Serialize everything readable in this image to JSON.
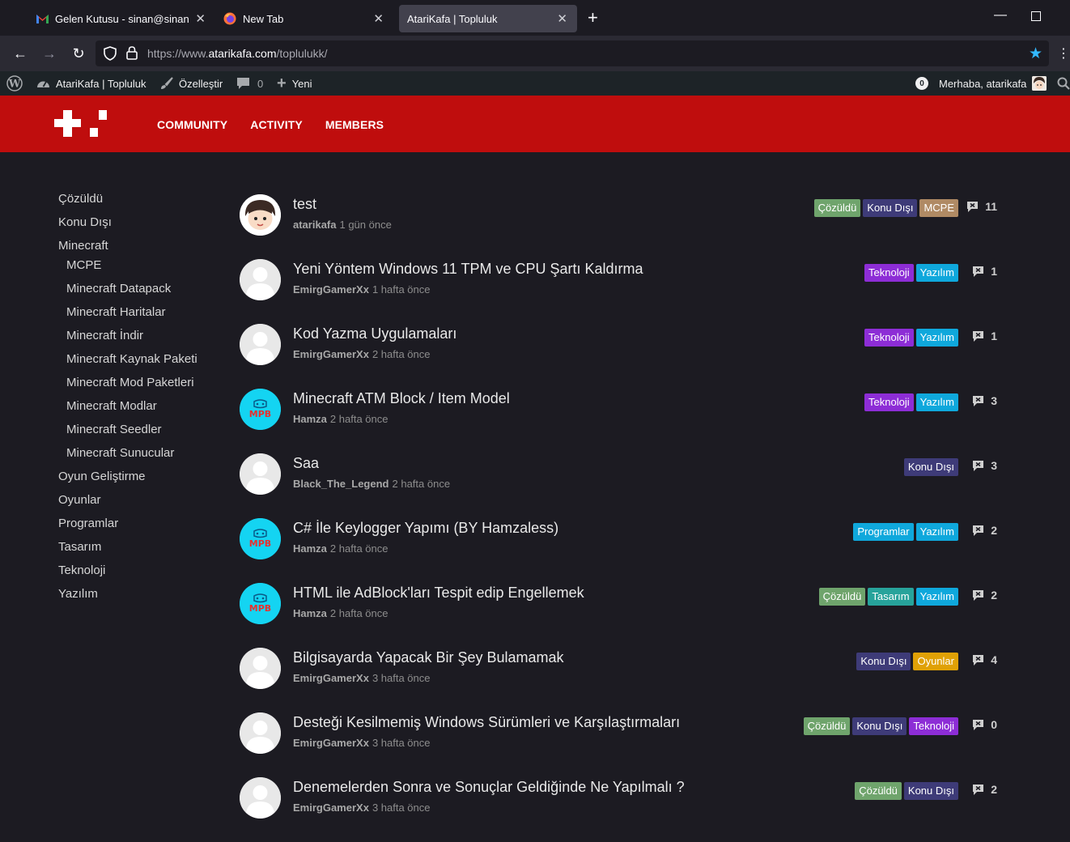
{
  "browser": {
    "tabs": [
      {
        "title": "Gelen Kutusu - sinan@sinanisle",
        "icon": "gmail-icon"
      },
      {
        "title": "New Tab",
        "icon": "firefox-icon"
      },
      {
        "title": "AtariKafa | Topluluk",
        "icon": "none",
        "active": true
      }
    ],
    "url_prefix": "https://www.",
    "url_domain": "atarikafa.com",
    "url_path": "/toplulukk/"
  },
  "adminbar": {
    "site": "AtariKafa | Topluluk",
    "customize": "Özelleştir",
    "comments": "0",
    "new": "Yeni",
    "notifications": "0",
    "greeting": "Merhaba, atarikafa"
  },
  "nav": {
    "items": [
      "COMMUNITY",
      "ACTIVITY",
      "MEMBERS"
    ]
  },
  "sidebar": {
    "items": [
      {
        "label": "Çözüldü",
        "sub": false
      },
      {
        "label": "Konu Dışı",
        "sub": false
      },
      {
        "label": "Minecraft",
        "sub": false,
        "tight": true
      },
      {
        "label": "MCPE",
        "sub": true
      },
      {
        "label": "Minecraft Datapack",
        "sub": true
      },
      {
        "label": "Minecraft Haritalar",
        "sub": true
      },
      {
        "label": "Minecraft İndir",
        "sub": true
      },
      {
        "label": "Minecraft Kaynak Paketi",
        "sub": true
      },
      {
        "label": "Minecraft Mod Paketleri",
        "sub": true
      },
      {
        "label": "Minecraft Modlar",
        "sub": true
      },
      {
        "label": "Minecraft Seedler",
        "sub": true
      },
      {
        "label": "Minecraft Sunucular",
        "sub": true
      },
      {
        "label": "Oyun Geliştirme",
        "sub": false
      },
      {
        "label": "Oyunlar",
        "sub": false
      },
      {
        "label": "Programlar",
        "sub": false
      },
      {
        "label": "Tasarım",
        "sub": false
      },
      {
        "label": "Teknoloji",
        "sub": false
      },
      {
        "label": "Yazılım",
        "sub": false
      }
    ]
  },
  "tag_colors": {
    "Çözüldü": "#6fa46c",
    "Konu Dışı": "#3e3b78",
    "MCPE": "#b08a64",
    "Teknoloji": "#8d2dd6",
    "Yazılım": "#0fa8dc",
    "Programlar": "#0fa8dc",
    "Tasarım": "#27a39b",
    "Oyunlar": "#e0a106"
  },
  "topics": [
    {
      "title": "test",
      "author": "atarikafa",
      "time": "1 gün önce",
      "tags": [
        "Çözüldü",
        "Konu Dışı",
        "MCPE"
      ],
      "replies": "11",
      "avatar": "test"
    },
    {
      "title": "Yeni Yöntem Windows 11 TPM ve CPU Şartı Kaldırma",
      "author": "EmirgGamerXx",
      "time": "1 hafta önce",
      "tags": [
        "Teknoloji",
        "Yazılım"
      ],
      "replies": "1",
      "avatar": "def"
    },
    {
      "title": "Kod Yazma Uygulamaları",
      "author": "EmirgGamerXx",
      "time": "2 hafta önce",
      "tags": [
        "Teknoloji",
        "Yazılım"
      ],
      "replies": "1",
      "avatar": "def"
    },
    {
      "title": "Minecraft ATM Block / Item Model",
      "author": "Hamza",
      "time": "2 hafta önce",
      "tags": [
        "Teknoloji",
        "Yazılım"
      ],
      "replies": "3",
      "avatar": "mpb"
    },
    {
      "title": "Saa",
      "author": "Black_The_Legend",
      "time": "2 hafta önce",
      "tags": [
        "Konu Dışı"
      ],
      "replies": "3",
      "avatar": "def"
    },
    {
      "title": "C# İle Keylogger Yapımı (BY Hamzaless)",
      "author": "Hamza",
      "time": "2 hafta önce",
      "tags": [
        "Programlar",
        "Yazılım"
      ],
      "replies": "2",
      "avatar": "mpb"
    },
    {
      "title": "HTML ile AdBlock'ları Tespit edip Engellemek",
      "author": "Hamza",
      "time": "2 hafta önce",
      "tags": [
        "Çözüldü",
        "Tasarım",
        "Yazılım"
      ],
      "replies": "2",
      "avatar": "mpb"
    },
    {
      "title": "Bilgisayarda Yapacak Bir Şey Bulamamak",
      "author": "EmirgGamerXx",
      "time": "3 hafta önce",
      "tags": [
        "Konu Dışı",
        "Oyunlar"
      ],
      "replies": "4",
      "avatar": "def"
    },
    {
      "title": "Desteği Kesilmemiş Windows Sürümleri ve Karşılaştırmaları",
      "author": "EmirgGamerXx",
      "time": "3 hafta önce",
      "tags": [
        "Çözüldü",
        "Konu Dışı",
        "Teknoloji"
      ],
      "replies": "0",
      "avatar": "def"
    },
    {
      "title": "Denemelerden Sonra ve Sonuçlar Geldiğinde Ne Yapılmalı ?",
      "author": "EmirgGamerXx",
      "time": "3 hafta önce",
      "tags": [
        "Çözüldü",
        "Konu Dışı"
      ],
      "replies": "2",
      "avatar": "def"
    }
  ]
}
